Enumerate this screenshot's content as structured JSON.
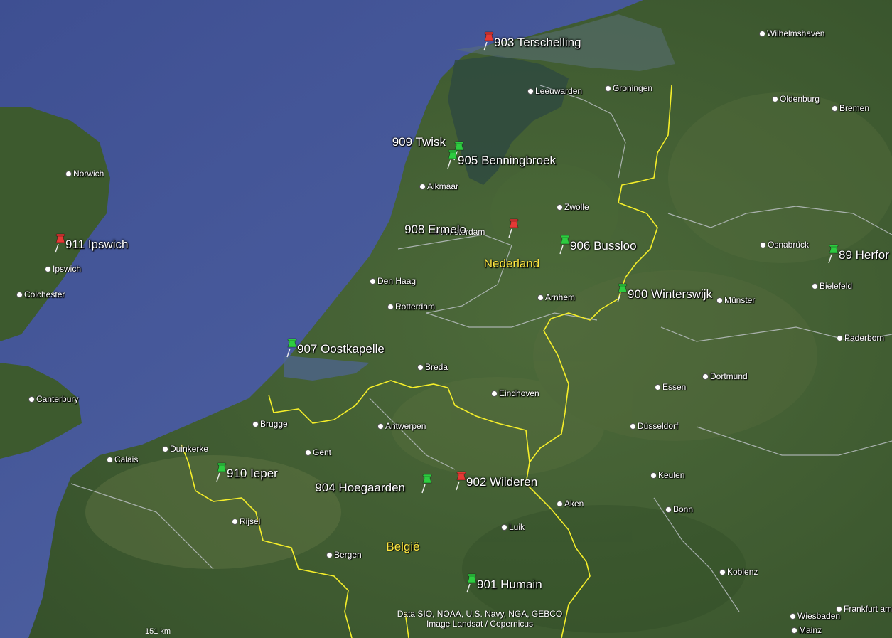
{
  "country_labels": [
    {
      "id": "nl",
      "text": "Nederland"
    },
    {
      "id": "be",
      "text": "België"
    }
  ],
  "cities": [
    {
      "id": "wilhelmshaven",
      "name": "Wilhelmshaven"
    },
    {
      "id": "leeuwarden",
      "name": "Leeuwarden"
    },
    {
      "id": "groningen",
      "name": "Groningen"
    },
    {
      "id": "oldenburg",
      "name": "Oldenburg"
    },
    {
      "id": "bremen",
      "name": "Bremen"
    },
    {
      "id": "norwich",
      "name": "Norwich"
    },
    {
      "id": "alkmaar",
      "name": "Alkmaar"
    },
    {
      "id": "zwolle",
      "name": "Zwolle"
    },
    {
      "id": "amsterdam",
      "name": "Amsterdam",
      "capital": true
    },
    {
      "id": "ipswich",
      "name": "Ipswich"
    },
    {
      "id": "colchester",
      "name": "Colchester"
    },
    {
      "id": "osnabruck",
      "name": "Osnabrück"
    },
    {
      "id": "den-haag",
      "name": "Den Haag"
    },
    {
      "id": "bielefeld",
      "name": "Bielefeld"
    },
    {
      "id": "arnhem",
      "name": "Arnhem"
    },
    {
      "id": "munster",
      "name": "Münster"
    },
    {
      "id": "rotterdam",
      "name": "Rotterdam"
    },
    {
      "id": "paderborn",
      "name": "Paderborn"
    },
    {
      "id": "breda",
      "name": "Breda"
    },
    {
      "id": "dortmund",
      "name": "Dortmund"
    },
    {
      "id": "essen",
      "name": "Essen"
    },
    {
      "id": "canterbury",
      "name": "Canterbury"
    },
    {
      "id": "eindhoven",
      "name": "Eindhoven"
    },
    {
      "id": "brugge",
      "name": "Brugge"
    },
    {
      "id": "antwerpen",
      "name": "Antwerpen"
    },
    {
      "id": "dusseldorf",
      "name": "Düsseldorf"
    },
    {
      "id": "duinkerke",
      "name": "Duinkerke"
    },
    {
      "id": "gent",
      "name": "Gent"
    },
    {
      "id": "calais",
      "name": "Calais"
    },
    {
      "id": "keulen",
      "name": "Keulen"
    },
    {
      "id": "aken",
      "name": "Aken"
    },
    {
      "id": "bonn",
      "name": "Bonn"
    },
    {
      "id": "rijsel",
      "name": "Rijsel"
    },
    {
      "id": "luik",
      "name": "Luik"
    },
    {
      "id": "bergen",
      "name": "Bergen"
    },
    {
      "id": "koblenz",
      "name": "Koblenz"
    },
    {
      "id": "wiesbaden",
      "name": "Wiesbaden"
    },
    {
      "id": "frankfurt",
      "name": "Frankfurt am"
    },
    {
      "id": "mainz",
      "name": "Mainz"
    }
  ],
  "placemarks": [
    {
      "id": "903",
      "label": "903 Terschelling",
      "color": "red"
    },
    {
      "id": "909",
      "label": "909 Twisk",
      "color": "green"
    },
    {
      "id": "905",
      "label": "905 Benningbroek",
      "color": "green"
    },
    {
      "id": "911",
      "label": "911 Ipswich",
      "color": "red"
    },
    {
      "id": "908",
      "label": "908 Ermelo",
      "color": "red"
    },
    {
      "id": "906",
      "label": "906 Bussloo",
      "color": "green"
    },
    {
      "id": "89",
      "label": "89 Herfor",
      "color": "green"
    },
    {
      "id": "900",
      "label": "900 Winterswijk",
      "color": "green"
    },
    {
      "id": "907",
      "label": "907 Oostkapelle",
      "color": "green"
    },
    {
      "id": "910",
      "label": "910 Ieper",
      "color": "green"
    },
    {
      "id": "904",
      "label": "904 Hoegaarden",
      "color": "green"
    },
    {
      "id": "902",
      "label": "902 Wilderen",
      "color": "red"
    },
    {
      "id": "901",
      "label": "901 Humain",
      "color": "green"
    }
  ],
  "colors": {
    "pin_red": "#e53935",
    "pin_green": "#2ecc40",
    "border": "#f5ee2a",
    "sea": "#4a5d9c",
    "land": "#3f5a30"
  },
  "attribution": {
    "line1": "Data SIO, NOAA, U.S. Navy, NGA, GEBCO",
    "line2": "Image Landsat / Copernicus"
  },
  "scale": {
    "label": "151 km"
  }
}
